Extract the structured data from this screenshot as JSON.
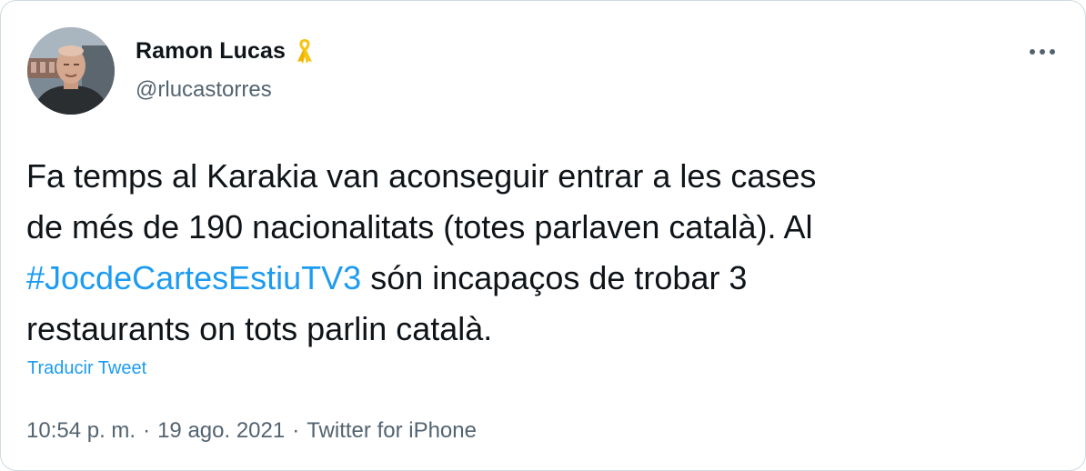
{
  "author": {
    "display_name": "Ramon Lucas",
    "handle": "@rlucastorres",
    "badge_icon": "yellow-ribbon-icon",
    "badge_color": "#f5c518"
  },
  "menu": {
    "more_icon": "more-horizontal-icon"
  },
  "tweet": {
    "line1": "Fa temps al Karakia van aconseguir entrar a les cases",
    "line2": "de més de 190 nacionalitats (totes parlaven català). Al",
    "hashtag": "#JocdeCartesEstiuTV3",
    "line3_rest": " són incapaços de trobar 3",
    "line4": "restaurants on tots parlin català."
  },
  "translate_label": "Traducir Tweet",
  "meta": {
    "time": "10:54 p. m.",
    "date": "19 ago. 2021",
    "source": "Twitter for iPhone",
    "separator": "·"
  },
  "colors": {
    "link": "#1d9bf0",
    "secondary_text": "#536471",
    "primary_text": "#0f1419",
    "border": "#cfd9de"
  }
}
